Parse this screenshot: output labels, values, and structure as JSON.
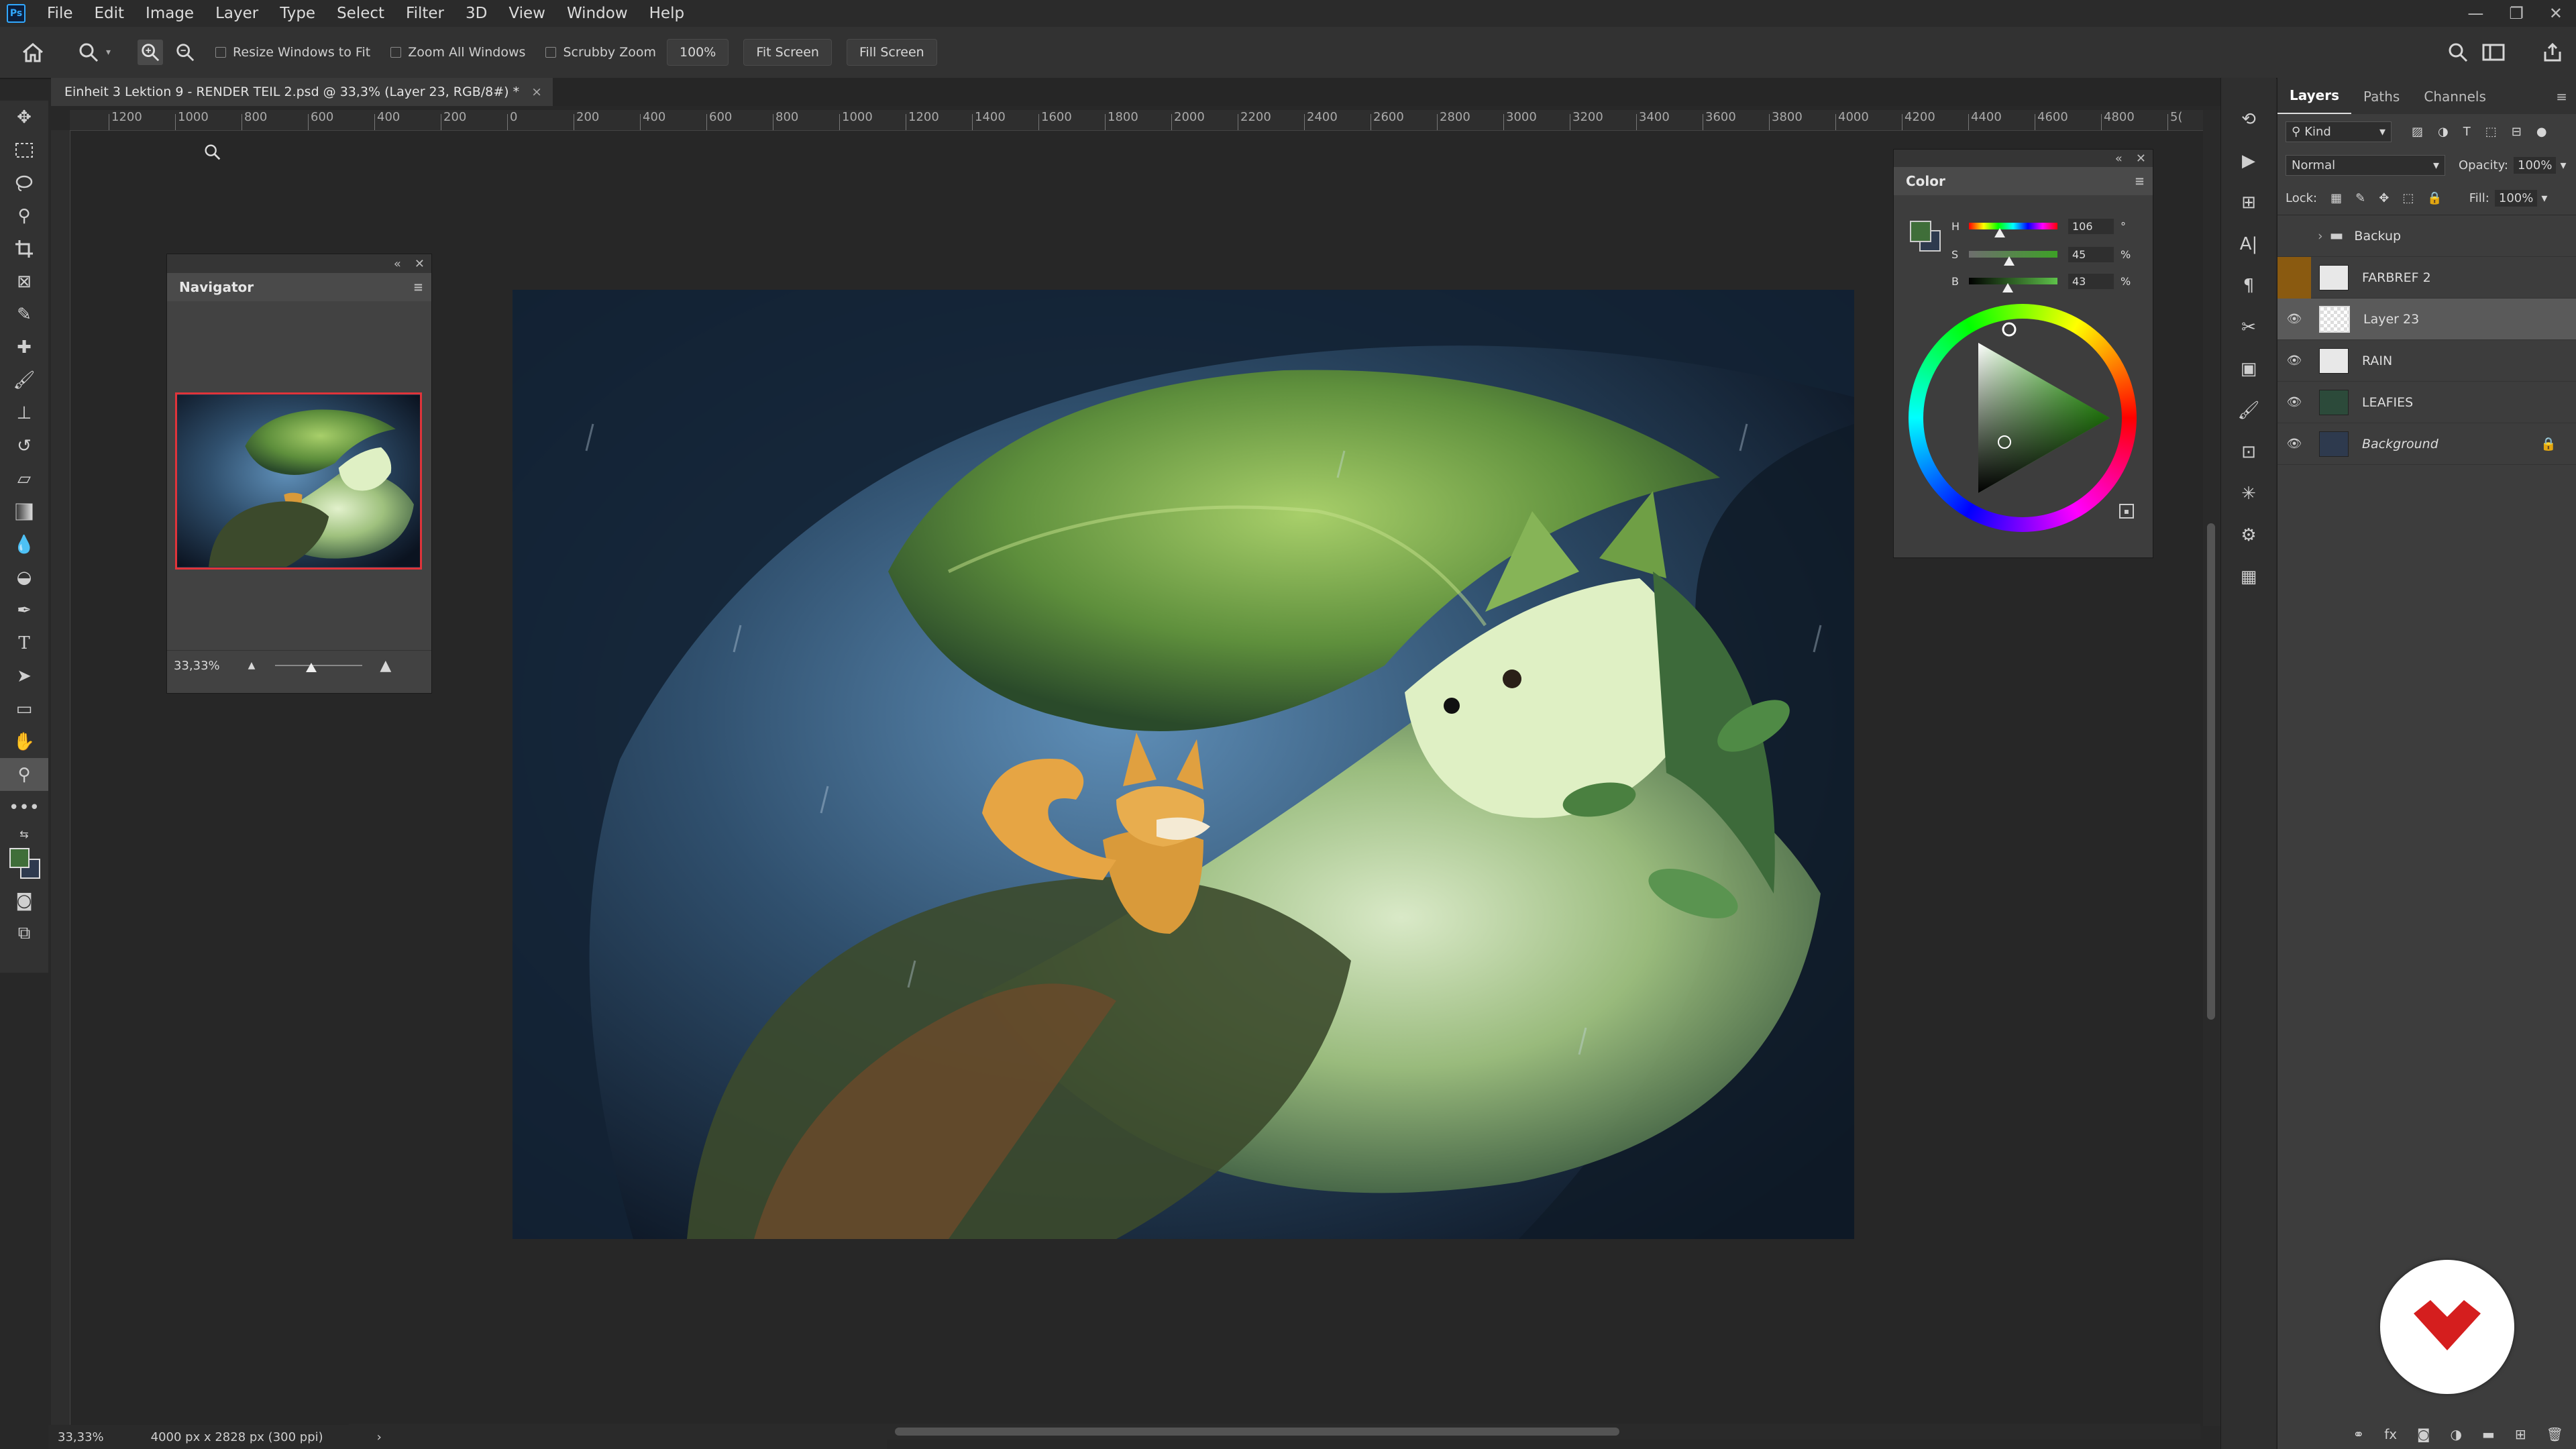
{
  "menubar": {
    "app_badge": "Ps",
    "items": [
      "File",
      "Edit",
      "Image",
      "Layer",
      "Type",
      "Select",
      "Filter",
      "3D",
      "View",
      "Window",
      "Help"
    ],
    "window_controls": [
      "—",
      "❐",
      "✕"
    ]
  },
  "options": {
    "resize_windows": "Resize Windows to Fit",
    "zoom_all": "Zoom All Windows",
    "scrubby": "Scrubby Zoom",
    "zoom_value": "100%",
    "fit_screen": "Fit Screen",
    "fill_screen": "Fill Screen"
  },
  "document": {
    "tab_title": "Einheit 3 Lektion 9 - RENDER TEIL 2.psd @ 33,3% (Layer 23, RGB/8#) *",
    "tab_close": "×"
  },
  "ruler": {
    "labels": [
      "1200",
      "1000",
      "800",
      "600",
      "400",
      "200",
      "0",
      "200",
      "400",
      "600",
      "800",
      "1000",
      "1200",
      "1400",
      "1600",
      "1800",
      "2000",
      "2200",
      "2400",
      "2600",
      "2800",
      "3000",
      "3200",
      "3400",
      "3600",
      "3800",
      "4000",
      "4200",
      "4400",
      "4600",
      "4800",
      "5("
    ]
  },
  "status": {
    "zoom": "33,33%",
    "doc_size": "4000 px x 2828 px (300 ppi)",
    "arrow": "›"
  },
  "navigator": {
    "title": "Navigator",
    "zoom": "33,33%"
  },
  "color": {
    "title": "Color",
    "h_label": "H",
    "h_value": "106",
    "h_unit": "°",
    "s_label": "S",
    "s_value": "45",
    "s_unit": "%",
    "b_label": "B",
    "b_value": "43",
    "b_unit": "%",
    "foreground": "#3f6e39",
    "background": "#2e3a4e"
  },
  "layers_panel": {
    "tabs": [
      "Layers",
      "Paths",
      "Channels"
    ],
    "kind": "Kind",
    "blend_mode": "Normal",
    "opacity_label": "Opacity:",
    "opacity_value": "100%",
    "lock_label": "Lock:",
    "fill_label": "Fill:",
    "fill_value": "100%",
    "layers": [
      {
        "name": "Backup",
        "type": "group",
        "visible": false
      },
      {
        "name": "FARBREF 2",
        "type": "layer",
        "visible": false
      },
      {
        "name": "Layer 23",
        "type": "layer",
        "visible": true,
        "selected": true
      },
      {
        "name": "RAIN",
        "type": "layer",
        "visible": true
      },
      {
        "name": "LEAFIES",
        "type": "layer",
        "visible": true
      },
      {
        "name": "Background",
        "type": "background",
        "visible": true
      }
    ]
  },
  "icons": {
    "home": "home-icon",
    "zoom": "zoom-icon",
    "search": "search-icon",
    "share": "share-icon"
  }
}
